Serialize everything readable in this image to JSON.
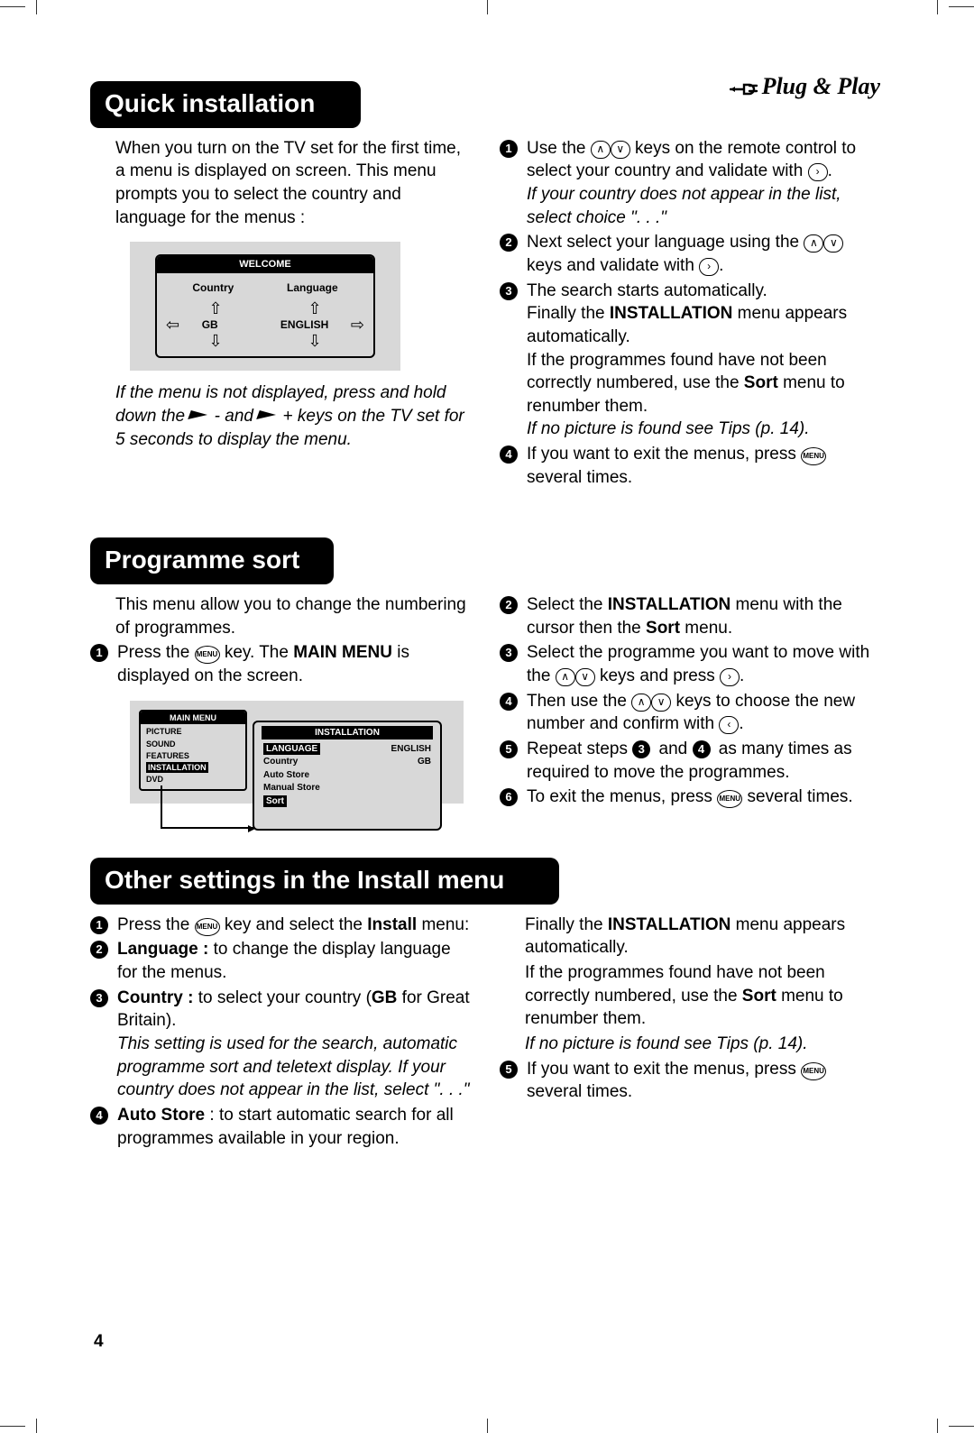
{
  "header": {
    "plug_play": "Plug & Play"
  },
  "s1": {
    "title": "Quick installation",
    "left_intro": "When you turn on the TV set for the first time, a menu is displayed on screen. This menu prompts you to select the country and language for the menus :",
    "welcome": {
      "title": "WELCOME",
      "country_label": "Country",
      "language_label": "Language",
      "country_value": "GB",
      "language_value": "ENGLISH"
    },
    "left_note_a": "If the menu is not displayed, press and hold down the ",
    "left_note_b": " - and ",
    "left_note_c": " + keys on the TV set for",
    "left_note_d": "5 seconds to display the menu.",
    "r1a": "Use the ",
    "r1b": " keys on the remote control to select your country and validate with ",
    "r1_dot": ".",
    "r1_note": "If your country does not appear in the list, select choice \". . .\"",
    "r2a": "Next select your language using the ",
    "r2b": " keys and validate with ",
    "r2_dot": ".",
    "r3a": "The search starts automatically.",
    "r3b_a": "Finally the ",
    "r3b_b": "INSTALLATION",
    "r3b_c": " menu appears automatically.",
    "r3c_a": "If the programmes found have not been correctly numbered, use the ",
    "r3c_b": "Sort",
    "r3c_c": " menu to renumber them.",
    "r3_note": "If no picture is found see Tips (p. 14).",
    "r4a": "If you want to exit the menus, press ",
    "r4b": " several times.",
    "menu_key": "MENU"
  },
  "s2": {
    "title": "Programme sort",
    "left_intro": "This menu allow you to change the numbering of programmes.",
    "l1a": "Press the ",
    "l1b": " key. The ",
    "l1c": "MAIN MENU",
    "l1d": " is displayed on the screen.",
    "main_menu": {
      "title": "MAIN MENU",
      "items": [
        "PICTURE",
        "SOUND",
        "FEATURES",
        "INSTALLATION",
        "DVD"
      ],
      "highlight": "INSTALLATION"
    },
    "install": {
      "title": "INSTALLATION",
      "rows": [
        {
          "l": "LANGUAGE",
          "r": "ENGLISH",
          "hl": true
        },
        {
          "l": "Country",
          "r": "GB"
        },
        {
          "l": "Auto Store",
          "r": ""
        },
        {
          "l": "Manual Store",
          "r": ""
        },
        {
          "l": "Sort",
          "r": "",
          "hlrow": true
        }
      ]
    },
    "r2a": "Select the ",
    "r2b": "INSTALLATION",
    "r2c": " menu with the cursor then the ",
    "r2d": "Sort",
    "r2e": " menu.",
    "r3a": "Select the programme you want to move with the ",
    "r3b": " keys and press ",
    "r3_dot": ".",
    "r4a": "Then use the ",
    "r4b": " keys to choose the new number and confirm with ",
    "r4_dot": ".",
    "r5a": "Repeat steps ",
    "r5b": " and ",
    "r5c": " as many times as required to move the programmes.",
    "r6a": "To exit the menus, press ",
    "r6b": " several times."
  },
  "s3": {
    "title": "Other settings in the Install menu",
    "l1a": "Press the ",
    "l1b": " key and select the ",
    "l1c": "Install",
    "l1d": " menu:",
    "l2a": "Language :",
    "l2b": " to change the display language for the menus.",
    "l3a": "Country :",
    "l3b": " to select your country (",
    "l3c": "GB",
    "l3d": " for Great Britain).",
    "l3_note": "This setting is used for the search, automatic programme sort and teletext display. If your country does not appear in the list, select \". . .\"",
    "l4a": "Auto Store",
    "l4b": " : to start automatic search for all programmes available in your region.",
    "r_a": "Finally the ",
    "r_b": "INSTALLATION",
    "r_c": " menu appears automatically.",
    "r_d": "If the programmes found have not been correctly numbered, use the ",
    "r_e": "Sort",
    "r_f": " menu to renumber them.",
    "r_note": "If no picture is found see Tips (p. 14).",
    "r5a": "If you want to exit the menus, press ",
    "r5b": " several times."
  },
  "page_number": "4"
}
